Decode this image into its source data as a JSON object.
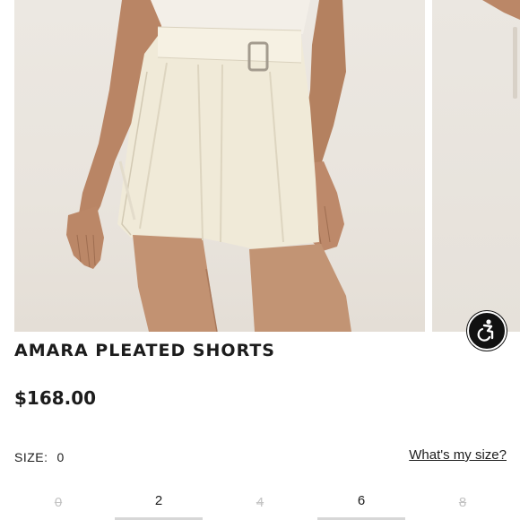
{
  "product": {
    "name": "AMARA PLEATED SHORTS",
    "price": "$168.00"
  },
  "size_selector": {
    "label": "SIZE:",
    "selected": "0",
    "guide_link": "What's my size?",
    "options": [
      {
        "label": "0",
        "available": false
      },
      {
        "label": "2",
        "available": true
      },
      {
        "label": "4",
        "available": false
      },
      {
        "label": "6",
        "available": true
      },
      {
        "label": "8",
        "available": false
      }
    ]
  },
  "gallery": {
    "main_image": "model wearing cream pleated belted shorts",
    "next_image": "partial next product photo"
  },
  "accessibility": {
    "icon": "accessibility-icon"
  }
}
